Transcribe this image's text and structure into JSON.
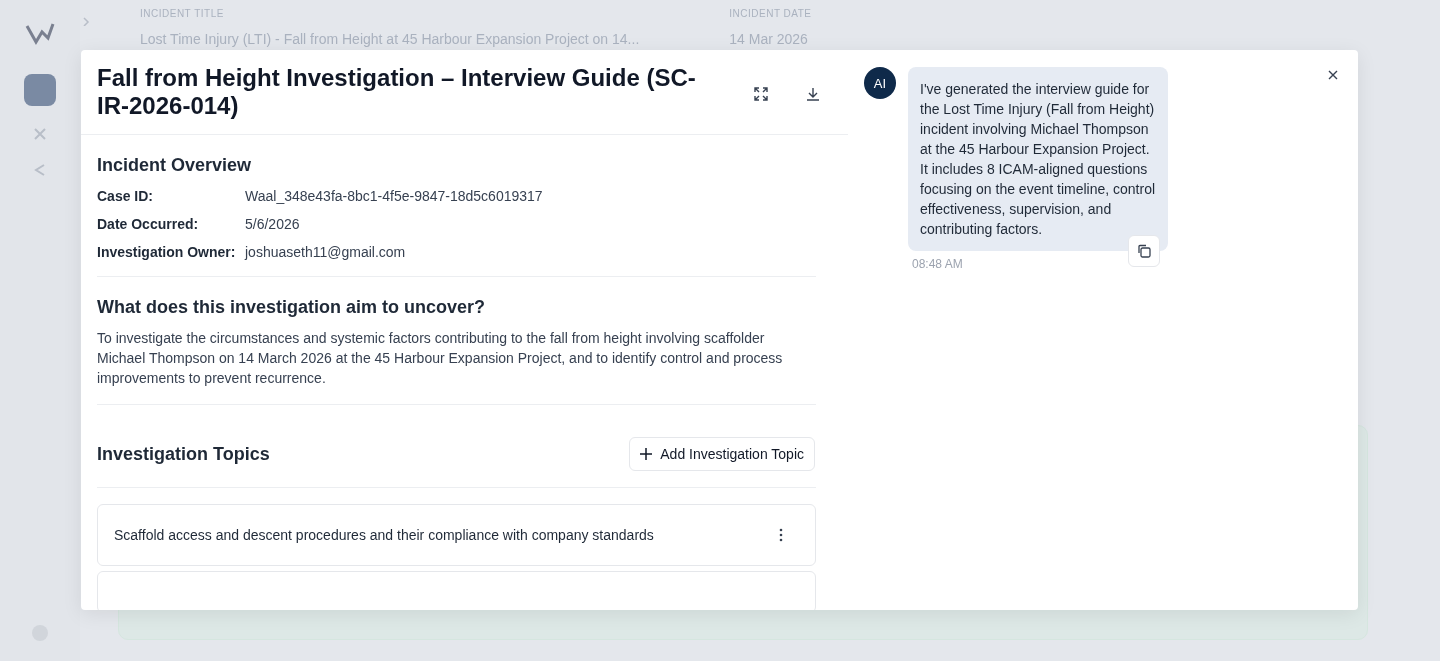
{
  "background": {
    "incident_title_label": "INCIDENT TITLE",
    "incident_title": "Lost Time Injury (LTI) - Fall from Height at 45 Harbour Expansion Project on 14...",
    "incident_date_label": "INCIDENT DATE",
    "incident_date": "14 Mar 2026"
  },
  "modal": {
    "title": "Fall from Height Investigation – Interview Guide (SC-IR-2026-014)",
    "overview": {
      "heading": "Incident Overview",
      "fields": [
        {
          "label": "Case ID:",
          "value": "Waal_348e43fa-8bc1-4f5e-9847-18d5c6019317"
        },
        {
          "label": "Date Occurred:",
          "value": "5/6/2026"
        },
        {
          "label": "Investigation Owner:",
          "value": "joshuaseth11@gmail.com"
        }
      ]
    },
    "aim": {
      "heading": "What does this investigation aim to uncover?",
      "text": "To investigate the circumstances and systemic factors contributing to the fall from height involving scaffolder Michael Thompson on 14 March 2026 at the 45 Harbour Expansion Project, and to identify control and process improvements to prevent recurrence."
    },
    "topics": {
      "heading": "Investigation Topics",
      "add_button": "Add Investigation Topic",
      "items": [
        {
          "text": "Scaffold access and descent procedures and their compliance with company standards"
        }
      ]
    }
  },
  "chat": {
    "avatar": "AI",
    "message": "I've generated the interview guide for the Lost Time Injury (Fall from Height) incident involving Michael Thompson at the 45 Harbour Expansion Project. It includes 8 ICAM-aligned questions focusing on the event timeline, control effectiveness, supervision, and contributing factors.",
    "time": "08:48 AM"
  }
}
